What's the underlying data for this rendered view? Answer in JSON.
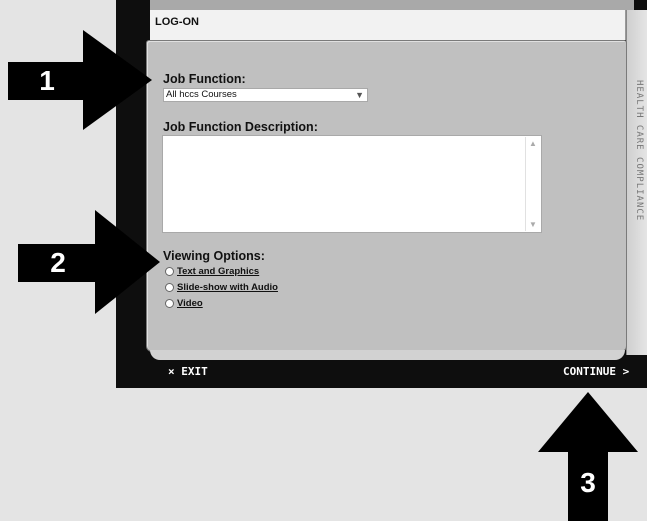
{
  "window": {
    "title": "LOG-ON",
    "side_banner": "HEALTH CARE COMPLIANCE"
  },
  "form": {
    "job_function_label": "Job Function:",
    "job_function_value": "All hccs Courses",
    "job_description_label": "Job Function Description:",
    "job_description_value": "",
    "viewing_options_label": "Viewing Options:",
    "viewing_options": [
      {
        "label": "Text and Graphics",
        "selected": false
      },
      {
        "label": "Slide-show with Audio",
        "selected": false
      },
      {
        "label": "Video",
        "selected": false
      }
    ]
  },
  "bottom_bar": {
    "exit_label": "× EXIT",
    "continue_label": "CONTINUE >"
  },
  "callouts": [
    {
      "number": "1"
    },
    {
      "number": "2"
    },
    {
      "number": "3"
    }
  ],
  "colors": {
    "frame": "#0e0e0e",
    "panel": "#c0c0c0",
    "background": "#e4e4e4",
    "callout": "#000000"
  }
}
